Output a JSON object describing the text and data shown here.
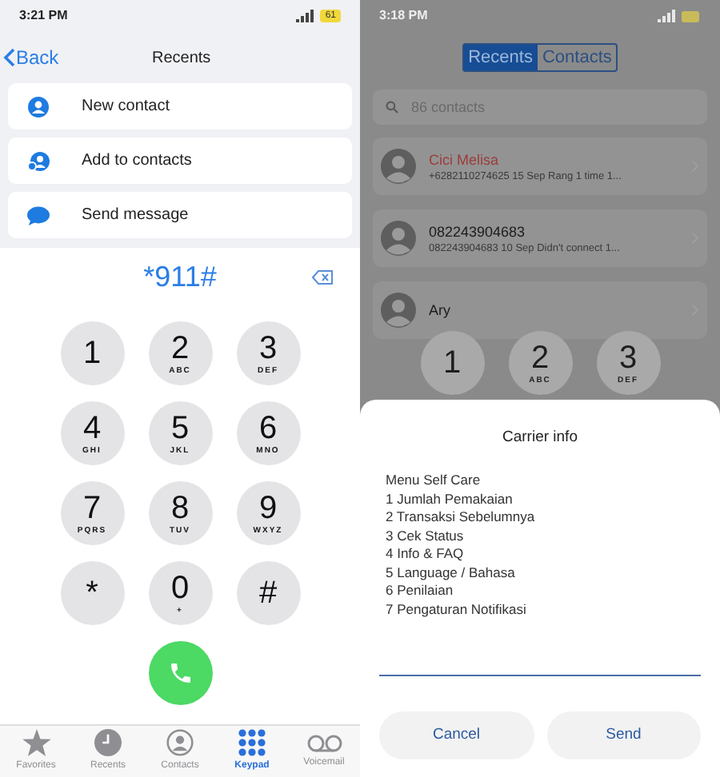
{
  "left": {
    "status": {
      "time": "3:21 PM",
      "battery": "61"
    },
    "header": {
      "back": "Back",
      "title": "Recents"
    },
    "actions": [
      {
        "kind": "person",
        "label": "New contact"
      },
      {
        "kind": "add",
        "label": "Add to contacts"
      },
      {
        "kind": "message",
        "label": "Send message"
      }
    ],
    "dialed": "*911#",
    "keys": [
      {
        "digit": "1"
      },
      {
        "digit": "2",
        "letters": "ABC"
      },
      {
        "digit": "3",
        "letters": "DEF"
      },
      {
        "digit": "4",
        "letters": "GHI"
      },
      {
        "digit": "5",
        "letters": "JKL"
      },
      {
        "digit": "6",
        "letters": "MNO"
      },
      {
        "digit": "7",
        "letters": "PQRS"
      },
      {
        "digit": "8",
        "letters": "TUV"
      },
      {
        "digit": "9",
        "letters": "WXYZ"
      },
      {
        "digit": "*"
      },
      {
        "digit": "0",
        "letters": "+"
      },
      {
        "digit": "#"
      }
    ],
    "tabs": [
      {
        "kind": "star",
        "label": "Favorites",
        "selected": false
      },
      {
        "kind": "clock",
        "label": "Recents",
        "selected": false
      },
      {
        "kind": "person",
        "label": "Contacts",
        "selected": false
      },
      {
        "kind": "grid",
        "label": "Keypad",
        "selected": true
      },
      {
        "kind": "voicemail",
        "label": "Voicemail",
        "selected": false
      }
    ]
  },
  "right": {
    "status": {
      "time": "3:18 PM"
    },
    "segments": [
      {
        "label": "Recents",
        "selected": true
      },
      {
        "label": "Contacts",
        "selected": false
      }
    ],
    "search": {
      "placeholder": "86 contacts"
    },
    "calls": [
      {
        "name": "Cici Melisa",
        "detail": "+6282110274625 15 Sep Rang 1 time 1...",
        "missed": true
      },
      {
        "name": "082243904683",
        "detail": "082243904683 10 Sep Didn't connect 1...",
        "missed": false
      },
      {
        "name": "Ary",
        "missed": false
      }
    ],
    "keys": [
      {
        "digit": "1"
      },
      {
        "digit": "2",
        "letters": "ABC"
      },
      {
        "digit": "3",
        "letters": "DEF"
      }
    ],
    "dialog": {
      "title": "Carrier info",
      "lines": [
        "Menu Self Care",
        "1 Jumlah Pemakaian",
        "2 Transaksi Sebelumnya",
        "3 Cek Status",
        "4 Info & FAQ",
        "5 Language / Bahasa",
        "6 Penilaian",
        "7 Pengaturan Notifikasi"
      ],
      "buttons": [
        "Cancel",
        "Send"
      ]
    }
  }
}
